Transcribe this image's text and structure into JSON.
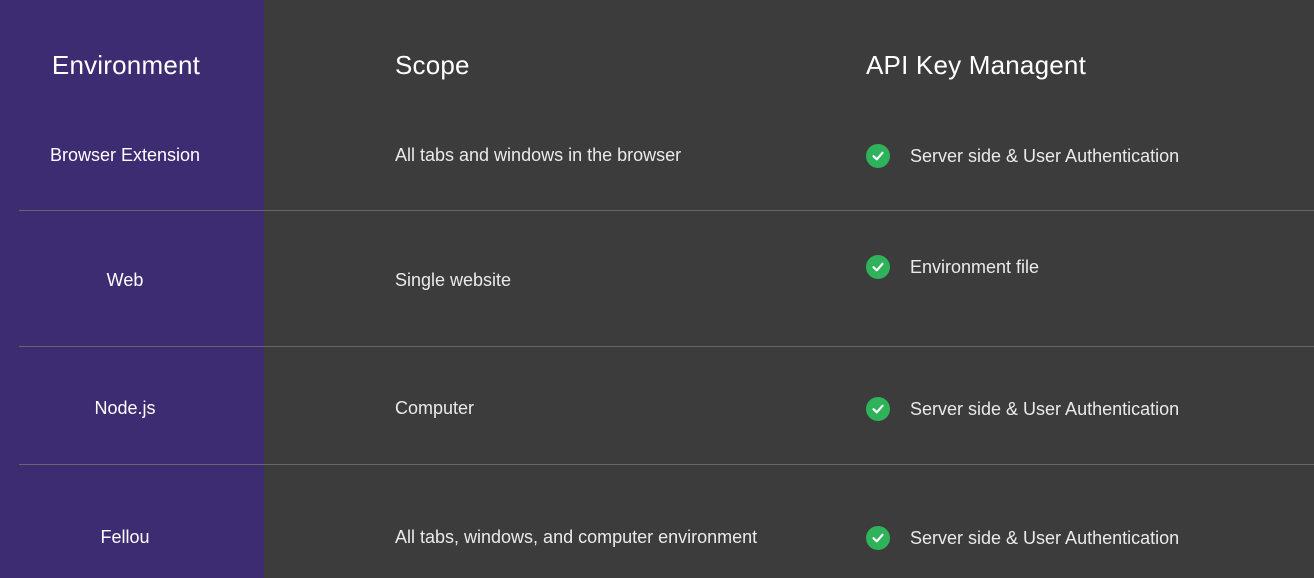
{
  "headers": {
    "environment": "Environment",
    "scope": "Scope",
    "api": "API Key Managent"
  },
  "colors": {
    "environment_column": "#3e2c72",
    "background": "#3c3c3c",
    "check": "#2fb35a"
  },
  "rows": [
    {
      "environment": "Browser Extension",
      "scope": "All tabs and windows in the browser",
      "api": "Server side & User Authentication",
      "icon": "check-circle-icon"
    },
    {
      "environment": "Web",
      "scope": "Single website",
      "api": "Environment file",
      "icon": "check-circle-icon"
    },
    {
      "environment": "Node.js",
      "scope": "Computer",
      "api": "Server side & User Authentication",
      "icon": "check-circle-icon"
    },
    {
      "environment": "Fellou",
      "scope": "All tabs, windows, and computer environment",
      "api": "Server side & User Authentication",
      "icon": "check-circle-icon"
    }
  ]
}
